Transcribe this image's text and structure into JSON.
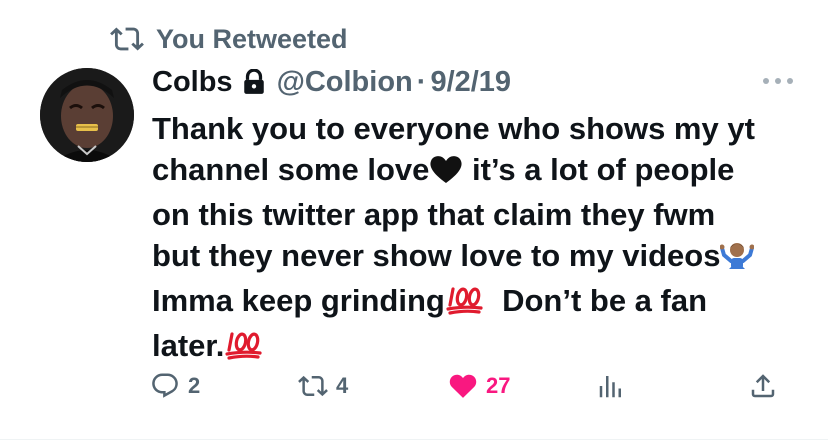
{
  "retweet_context": {
    "label": "You Retweeted",
    "icon": "retweet-icon"
  },
  "tweet": {
    "author_name": "Colbs",
    "handle": "@Colbion",
    "separator": "·",
    "date": "9/2/19",
    "protected": true,
    "text_lines": [
      {
        "before": "Thank you to everyone who shows my yt",
        "after": ""
      },
      {
        "before": "channel some love",
        "emoji": "black-heart",
        "after": " it’s a lot of people"
      },
      {
        "before": "on this twitter app that claim they fwm",
        "after": ""
      },
      {
        "before": "but they never show love to my videos",
        "emoji": "person-shrugging",
        "after": ""
      },
      {
        "before": "Imma keep grinding",
        "emoji": "hundred-points",
        "after": "  Don’t be a fan"
      },
      {
        "before": "later.",
        "emoji": "hundred-points",
        "after": ""
      }
    ]
  },
  "actions": {
    "replies": "2",
    "retweets": "4",
    "likes": "27",
    "views": "",
    "liked": true
  },
  "colors": {
    "text": "#0f1419",
    "secondary": "#536471",
    "like": "#f91880",
    "retweet_icon": "#536471"
  }
}
